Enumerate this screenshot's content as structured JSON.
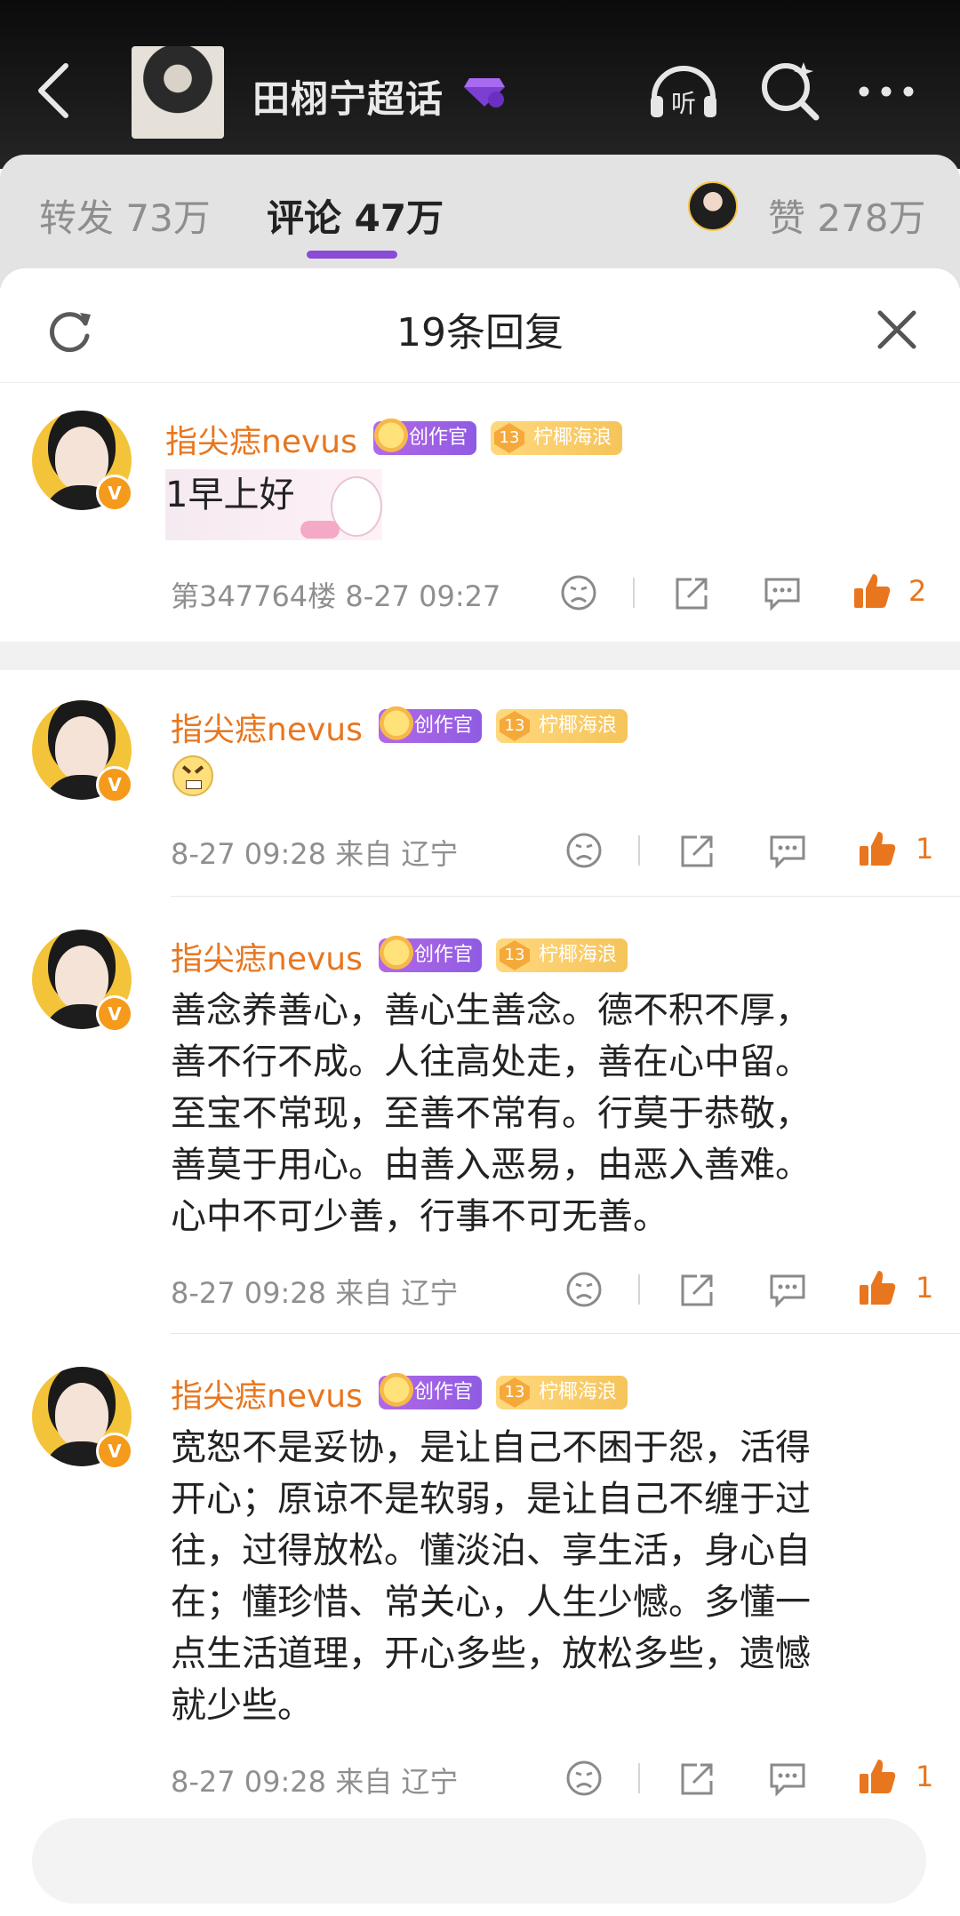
{
  "header": {
    "title": "田栩宁超话"
  },
  "tabs": {
    "repost": "转发 73万",
    "comment": "评论 47万",
    "like": "赞 278万"
  },
  "sheet": {
    "title": "19条回复"
  },
  "comments": [
    {
      "name": "指尖痣nevus",
      "badge_creator": "创作官",
      "badge_level_num": "13",
      "badge_level": "柠椰海浪",
      "text": "1早上好",
      "meta": "第347764楼  8-27 09:27",
      "likes": "2"
    },
    {
      "name": "指尖痣nevus",
      "badge_creator": "创作官",
      "badge_level_num": "13",
      "badge_level": "柠椰海浪",
      "meta": "8-27 09:28  来自 辽宁",
      "likes": "1"
    },
    {
      "name": "指尖痣nevus",
      "badge_creator": "创作官",
      "badge_level_num": "13",
      "badge_level": "柠椰海浪",
      "lines": [
        "善念养善心，善心生善念。德不积不厚，",
        "善不行不成。人往高处走，善在心中留。",
        "至宝不常现，至善不常有。行莫于恭敬，",
        "善莫于用心。由善入恶易，由恶入善难。",
        "心中不可少善，行事不可无善。"
      ],
      "meta": "8-27 09:28  来自 辽宁",
      "likes": "1"
    },
    {
      "name": "指尖痣nevus",
      "badge_creator": "创作官",
      "badge_level_num": "13",
      "badge_level": "柠椰海浪",
      "lines": [
        "宽恕不是妥协，是让自己不困于怨，活得",
        "开心；原谅不是软弱，是让自己不缠于过",
        "往，过得放松。懂淡泊、享生活，身心自",
        "在；懂珍惜、常关心，人生少憾。多懂一",
        "点生活道理，开心多些，放松多些，遗憾",
        "就少些。"
      ],
      "meta": "8-27 09:28  来自 辽宁",
      "likes": "1"
    }
  ],
  "colors": {
    "accent_orange": "#e8761f",
    "tab_indicator": "#8a4bd6",
    "creator_badge": "#9d60e4",
    "level_badge": "#f5c45a"
  },
  "icons": [
    "back-icon",
    "super-topic-gem-icon",
    "listen-icon",
    "search-icon",
    "more-icon",
    "refresh-icon",
    "close-icon",
    "dislike-icon",
    "share-icon",
    "comment-icon",
    "like-icon"
  ]
}
